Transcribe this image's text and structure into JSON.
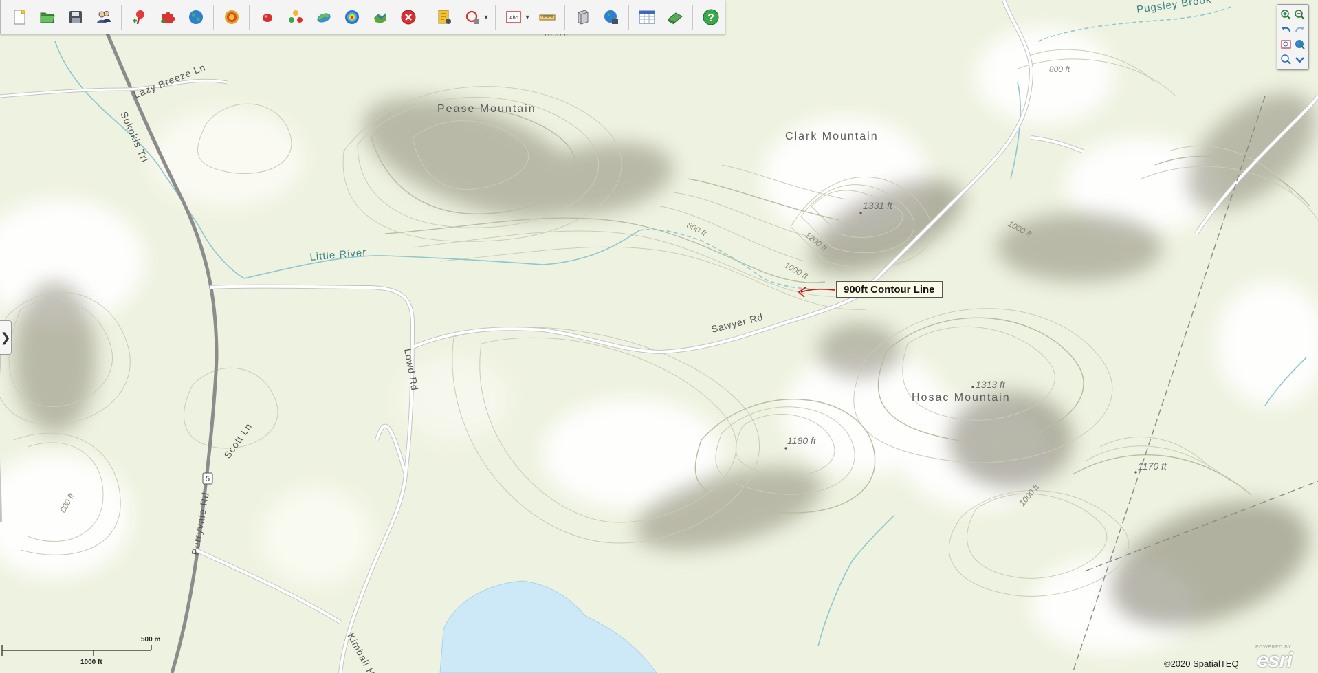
{
  "toolbar": {
    "buttons": [
      {
        "name": "new-document-icon"
      },
      {
        "name": "open-folder-icon"
      },
      {
        "name": "save-icon"
      },
      {
        "name": "users-icon"
      },
      {
        "name": "add-pin-icon"
      },
      {
        "name": "puzzle-icon"
      },
      {
        "name": "globe-icon"
      },
      {
        "name": "target-icon"
      },
      {
        "name": "single-point-icon"
      },
      {
        "name": "multi-point-icon"
      },
      {
        "name": "layer-icon"
      },
      {
        "name": "heatmap-icon"
      },
      {
        "name": "map-pieces-icon"
      },
      {
        "name": "delete-icon"
      },
      {
        "name": "report-icon"
      },
      {
        "name": "lasso-select-icon"
      },
      {
        "name": "text-box-icon"
      },
      {
        "name": "ruler-icon"
      },
      {
        "name": "print-icon"
      },
      {
        "name": "export-map-icon"
      },
      {
        "name": "calculator-icon"
      },
      {
        "name": "eraser-icon"
      },
      {
        "name": "help-icon"
      }
    ],
    "text_tool_label": "Abc"
  },
  "nav": {
    "buttons": [
      "zoom-in-icon",
      "zoom-out-icon",
      "back-icon",
      "forward-icon",
      "zoom-box-icon",
      "full-extent-icon",
      "magnify-icon",
      "collapse-icon"
    ]
  },
  "side_toggle": "❯",
  "callout": {
    "label": "900ft Contour Line",
    "arrow_color": "#d11b1b"
  },
  "map": {
    "places": [
      {
        "key": "pease",
        "text": "Pease Mountain"
      },
      {
        "key": "clark",
        "text": "Clark Mountain"
      },
      {
        "key": "hosac",
        "text": "Hosac Mountain"
      }
    ],
    "water": [
      {
        "key": "pugsley",
        "text": "Pugsley Brook"
      },
      {
        "key": "little",
        "text": "Little River"
      }
    ],
    "roads": [
      {
        "key": "lazy",
        "text": "Lazy Breeze Ln"
      },
      {
        "key": "sokokis",
        "text": "Sokokis Trl"
      },
      {
        "key": "sawyer",
        "text": "Sawyer Rd"
      },
      {
        "key": "lowd",
        "text": "Lowd Rd"
      },
      {
        "key": "scott",
        "text": "Scott Ln"
      },
      {
        "key": "perryvale",
        "text": "Perryvale Rd"
      },
      {
        "key": "kimball",
        "text": "Kimball H"
      },
      {
        "key": "route",
        "text": "5"
      }
    ],
    "elevations": [
      {
        "key": "e1331",
        "text": "1331 ft"
      },
      {
        "key": "e1313",
        "text": "1313 ft"
      },
      {
        "key": "e1180",
        "text": "1180 ft"
      },
      {
        "key": "e1170",
        "text": "1170 ft"
      }
    ],
    "contour_labels": [
      {
        "key": "c800a",
        "text": "800 ft"
      },
      {
        "key": "c800b",
        "text": "800 ft"
      },
      {
        "key": "c1200",
        "text": "1200 ft"
      },
      {
        "key": "c1000a",
        "text": "1000 ft"
      },
      {
        "key": "c1000b",
        "text": "1000 ft"
      },
      {
        "key": "c1000c",
        "text": "1000 ft"
      },
      {
        "key": "c600",
        "text": "600 ft"
      },
      {
        "key": "c1000top",
        "text": "1000 ft"
      }
    ]
  },
  "scalebar": {
    "metric": "500 m",
    "imperial": "1000 ft"
  },
  "copyright": "©2020 SpatialTEQ",
  "logo": {
    "powered": "POWERED BY",
    "word": "esri"
  },
  "colors": {
    "land": "#eef2e0",
    "relief": "#8e8b7a",
    "water": "#cde8f6",
    "river": "#8fc7cf",
    "road": "#ffffff",
    "highway": "#8c8c8c"
  }
}
